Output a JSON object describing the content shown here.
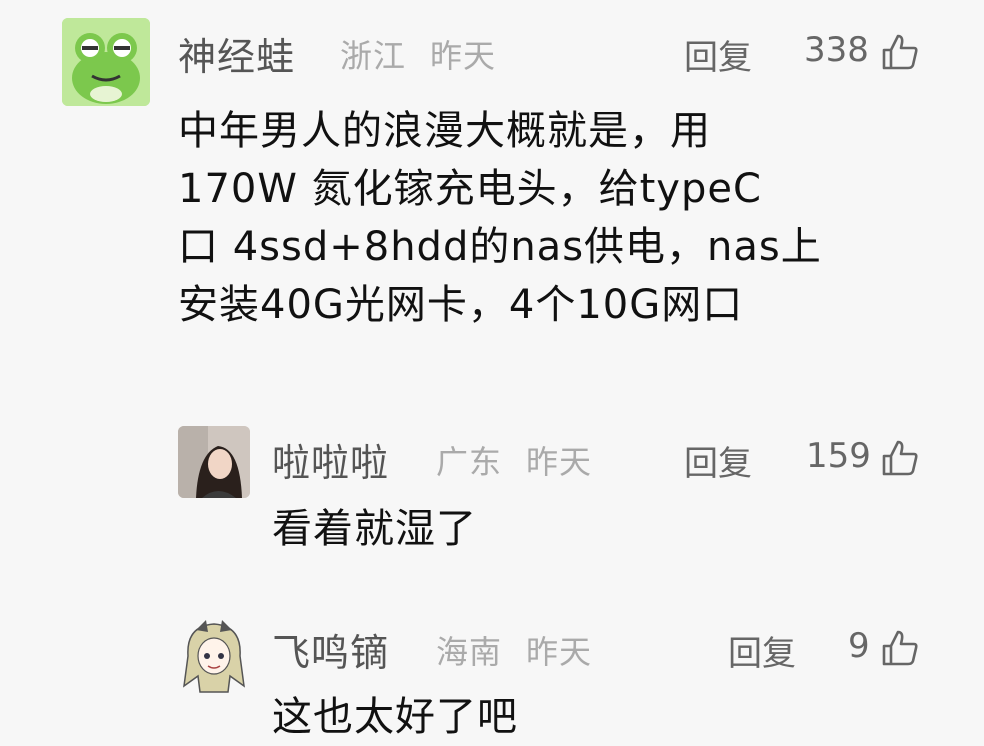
{
  "comments": [
    {
      "name": "神经蛙",
      "location": "浙江",
      "time": "昨天",
      "reply_label": "回复",
      "likes": "338",
      "avatar_icon": "frog-avatar-icon",
      "lines": [
        "中年男人的浪漫大概就是，用",
        "170W 氮化镓充电头，给typeC",
        "口 4ssd+8hdd的nas供电，nas上",
        "安装40G光网卡，4个10G网口"
      ]
    },
    {
      "name": "啦啦啦",
      "location": "广东",
      "time": "昨天",
      "reply_label": "回复",
      "likes": "159",
      "avatar_icon": "woman-photo-avatar-icon",
      "lines": [
        "看着就湿了"
      ]
    },
    {
      "name": "飞鸣镝",
      "location": "海南",
      "time": "昨天",
      "reply_label": "回复",
      "likes": "9",
      "avatar_icon": "anime-girl-avatar-icon",
      "lines": [
        "这也太好了吧"
      ]
    }
  ],
  "colors": {
    "background": "#f7f7f7",
    "name": "#555555",
    "meta": "#aaaaaa",
    "text": "#111111",
    "frog_green": "#8fd35c"
  }
}
